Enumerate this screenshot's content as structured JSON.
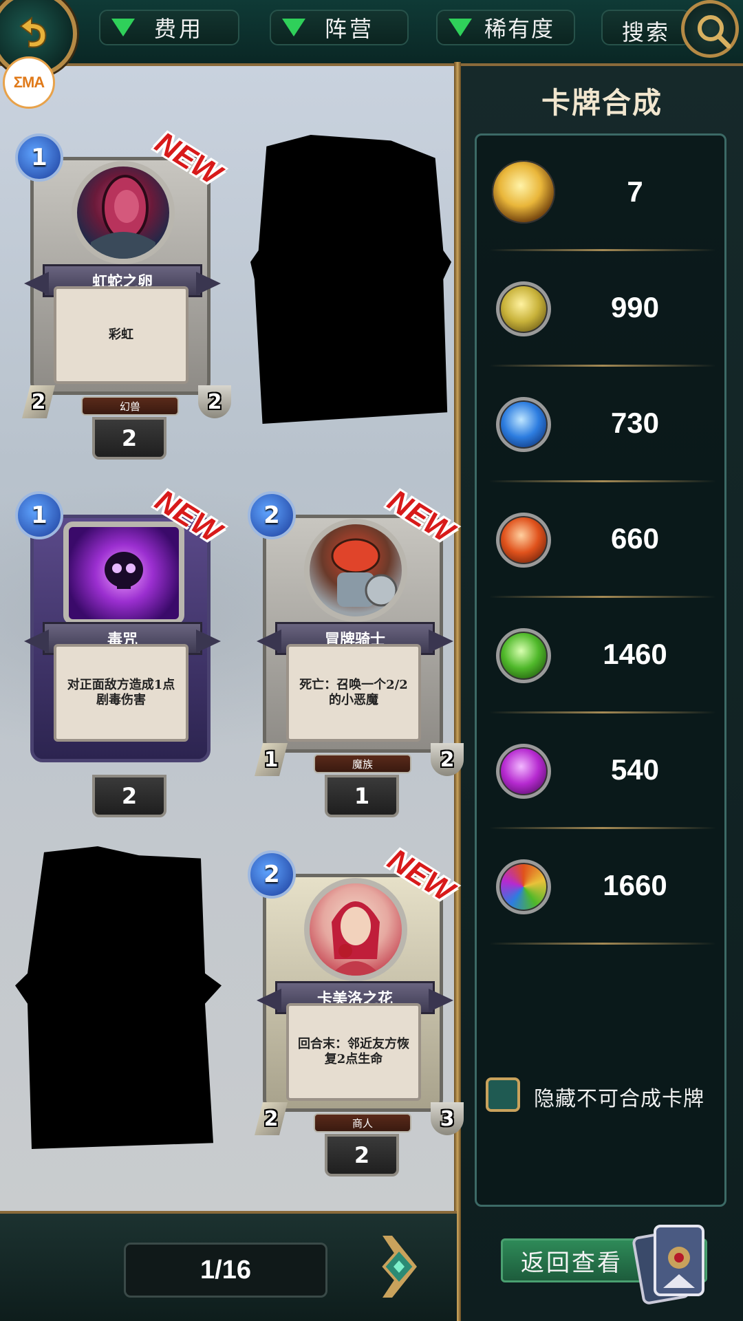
{
  "topbar": {
    "filters": [
      {
        "label": "费用"
      },
      {
        "label": "阵营"
      },
      {
        "label": "稀有度"
      }
    ],
    "search_label": "搜索",
    "logo_text": "ΣMA"
  },
  "cards": [
    {
      "name": "虹蛇之卵",
      "text": "彩虹",
      "mana": "1",
      "attack": "2",
      "health": "2",
      "tribe": "幻兽",
      "count": "2",
      "is_new": "NEW",
      "kind": "minion",
      "art_color": "#c63b6a"
    },
    {
      "name": "毒咒",
      "text": "对正面敌方造成1点剧毒伤害",
      "mana": "1",
      "count": "2",
      "is_new": "NEW",
      "kind": "spell",
      "art_color": "#9b2fd0"
    },
    {
      "name": "冒牌骑士",
      "text": "死亡：召唤一个2/2的小恶魔",
      "mana": "2",
      "attack": "1",
      "health": "2",
      "tribe": "魔族",
      "count": "1",
      "is_new": "NEW",
      "kind": "minion",
      "art_color": "#d8442c"
    },
    {
      "name": "卡美洛之花",
      "text": "回合末：邻近友方恢复2点生命",
      "mana": "2",
      "attack": "2",
      "health": "3",
      "tribe": "商人",
      "count": "2",
      "is_new": "NEW",
      "kind": "minion",
      "art_color": "#c23a4a"
    }
  ],
  "panel": {
    "title": "卡牌合成",
    "resources": [
      {
        "icon": "gold-essence-icon",
        "value": "7",
        "color": "#e9b63a"
      },
      {
        "icon": "light-essence-icon",
        "value": "990",
        "color": "#c8b23a"
      },
      {
        "icon": "water-essence-icon",
        "value": "730",
        "color": "#2d7de0"
      },
      {
        "icon": "fire-essence-icon",
        "value": "660",
        "color": "#e0521c"
      },
      {
        "icon": "nature-essence-icon",
        "value": "1460",
        "color": "#4fb82a"
      },
      {
        "icon": "arcane-essence-icon",
        "value": "540",
        "color": "#b62ad0"
      },
      {
        "icon": "rainbow-essence-icon",
        "value": "1660",
        "color": "#e06a2a"
      }
    ],
    "hide_label": "隐藏不可合成卡牌"
  },
  "footer": {
    "page": "1/16",
    "return_label": "返回查看"
  }
}
